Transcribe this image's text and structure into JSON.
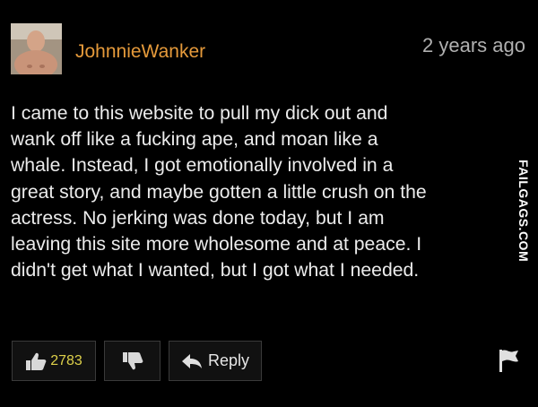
{
  "comment": {
    "username": "JohnnieWanker",
    "timestamp": "2 years ago",
    "body": "I came to this website to pull my dick out and\nwank off like a fucking ape, and moan like a\nwhale. Instead, I got emotionally involved in a\ngreat story, and maybe gotten a little crush on the\nactress. No jerking was done today, but I am\nleaving this site more wholesome and at peace. I\ndidn't get what I wanted, but I got what I needed."
  },
  "actions": {
    "like_count": "2783",
    "reply_label": "Reply"
  },
  "watermark": "FAILGAGS.COM",
  "colors": {
    "background": "#000000",
    "username": "#e59a3b",
    "like_count": "#ddd04a",
    "text": "#ececec"
  },
  "icons": [
    "avatar",
    "thumbs-up-icon",
    "thumbs-down-icon",
    "reply-arrow-icon",
    "flag-icon"
  ]
}
